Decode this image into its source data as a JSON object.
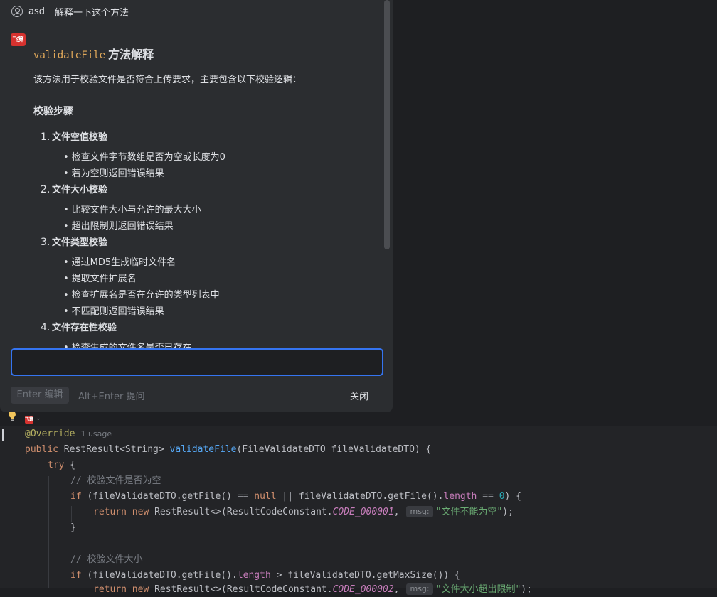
{
  "popup": {
    "user_name": "asd",
    "question": "解释一下这个方法",
    "bot_logo_text": "飞算",
    "answer": {
      "title_code": "validateFile",
      "title_text": "方法解释",
      "intro": "该方法用于校验文件是否符合上传要求，主要包含以下校验逻辑：",
      "section_heading": "校验步骤",
      "steps": [
        {
          "num": "1.",
          "title": "文件空值校验",
          "bullets": [
            "检查文件字节数组是否为空或长度为0",
            "若为空则返回错误结果"
          ]
        },
        {
          "num": "2.",
          "title": "文件大小校验",
          "bullets": [
            "比较文件大小与允许的最大大小",
            "超出限制则返回错误结果"
          ]
        },
        {
          "num": "3.",
          "title": "文件类型校验",
          "bullets": [
            "通过MD5生成临时文件名",
            "提取文件扩展名",
            "检查扩展名是否在允许的类型列表中",
            "不匹配则返回错误结果"
          ]
        },
        {
          "num": "4.",
          "title": "文件存在性校验",
          "bullets": [
            "检查生成的文件名是否已存在"
          ]
        }
      ]
    },
    "input_value": "",
    "edit_button_label": "Enter 编辑",
    "submit_hint": "Alt+Enter 提问",
    "close_label": "关闭"
  },
  "gutter": {
    "logo_text": "飞算",
    "chevron": "⌄"
  },
  "editor": {
    "usage_hint": "1 usage",
    "lines": {
      "l1_ann": "@Override",
      "l2_kw": "public",
      "l2_type": "RestResult<String>",
      "l2_fn": "validateFile",
      "l2_params": "(FileValidateDTO fileValidateDTO) {",
      "l3_kw": "try",
      "l3_rest": " {",
      "l4_comment": "// 校验文件是否为空",
      "l5_kw": "if",
      "l5_a": " (fileValidateDTO.getFile() == ",
      "l5_null": "null",
      "l5_b": " || fileValidateDTO.getFile().",
      "l5_field": "length",
      "l5_c": " == ",
      "l5_num": "0",
      "l5_d": ") {",
      "l6_kw1": "return",
      "l6_kw2": "new",
      "l6_a": " RestResult<>(ResultCodeConstant.",
      "l6_const": "CODE_000001",
      "l6_comma": ",",
      "l6_param_hint": "msg:",
      "l6_str": "\"文件不能为空\"",
      "l6_end": ");",
      "l7": "}",
      "l9_comment": "// 校验文件大小",
      "l10_kw": "if",
      "l10_a": " (fileValidateDTO.getFile().",
      "l10_field": "length",
      "l10_b": " > fileValidateDTO.getMaxSize()) {",
      "l11_kw1": "return",
      "l11_kw2": "new",
      "l11_a": " RestResult<>(ResultCodeConstant.",
      "l11_const": "CODE_000002",
      "l11_comma": ",",
      "l11_param_hint": "msg:",
      "l11_str": "\"文件大小超出限制\"",
      "l11_end": ");"
    }
  },
  "icons": [
    "user-icon",
    "lightbulb-icon",
    "chevron-down-icon"
  ],
  "colors": {
    "accent": "#3574f0",
    "brand": "#d6322f",
    "keyword": "#cf8e6d",
    "function": "#56a8f5",
    "string": "#6aab73"
  }
}
